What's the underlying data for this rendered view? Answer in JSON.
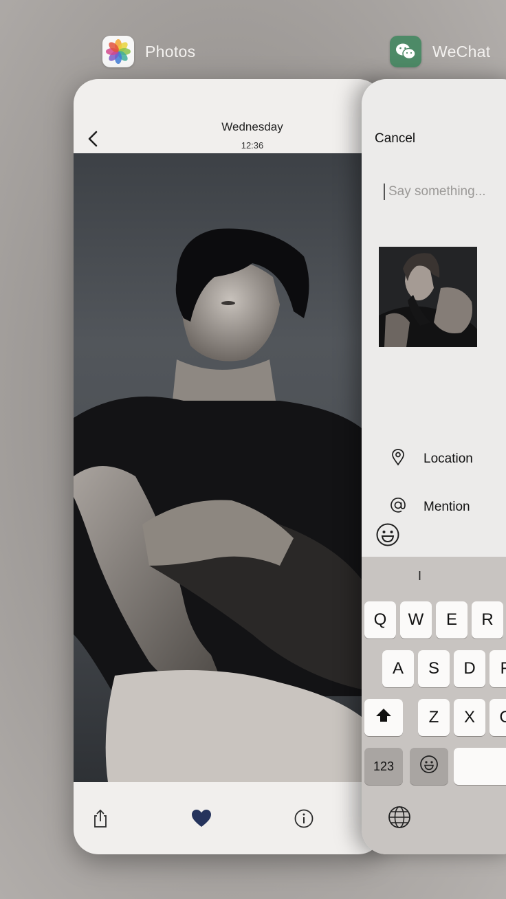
{
  "switcher": {
    "apps": [
      {
        "name": "Photos"
      },
      {
        "name": "WeChat"
      }
    ]
  },
  "photos": {
    "header": {
      "day": "Wednesday",
      "time": "12:36"
    },
    "icons": {
      "back": "chevron-left-icon",
      "share": "share-icon",
      "favorite": "heart-icon",
      "info": "info-icon"
    },
    "favorite_color": "#25335c"
  },
  "wechat": {
    "cancel_label": "Cancel",
    "input": {
      "placeholder": "Say something...",
      "value": ""
    },
    "rows": [
      {
        "label": "Location",
        "icon": "location-pin-icon"
      },
      {
        "label": "Mention",
        "icon": "at-icon"
      }
    ],
    "keyboard": {
      "suggestion": "I",
      "row1": [
        "Q",
        "W",
        "E",
        "R"
      ],
      "row2": [
        "A",
        "S",
        "D",
        "F"
      ],
      "row3": [
        "Z",
        "X",
        "C"
      ],
      "numbers_label": "123",
      "icons": {
        "shift": "shift-icon",
        "emoji": "emoji-icon",
        "globe": "globe-icon"
      }
    }
  }
}
